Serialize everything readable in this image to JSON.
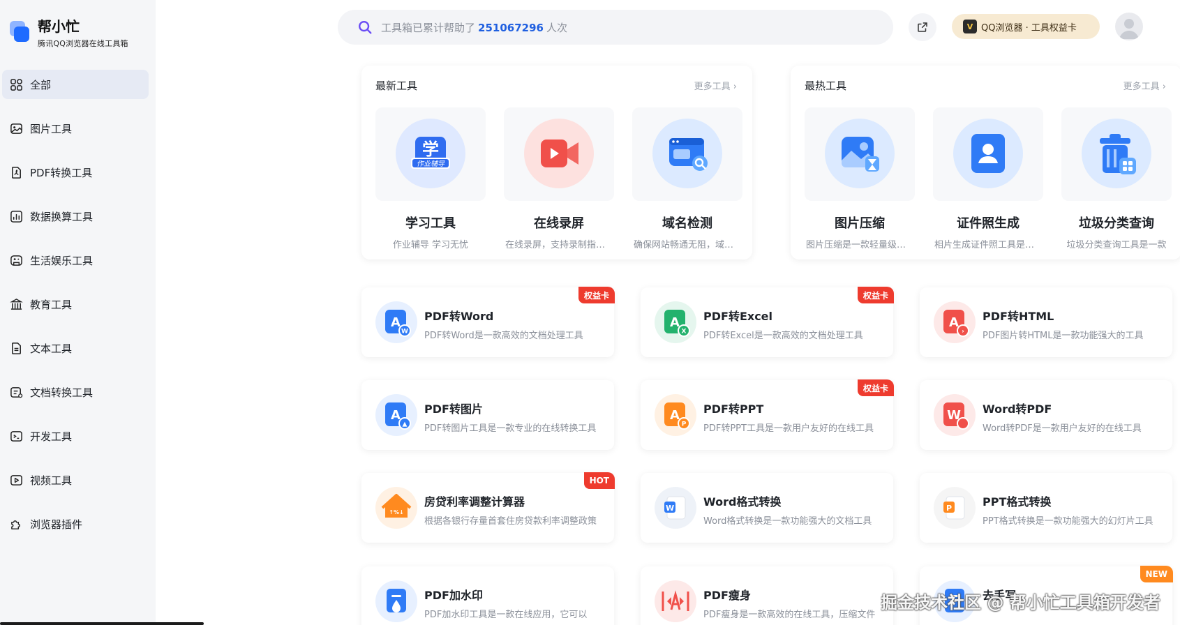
{
  "brand": {
    "title": "帮小忙",
    "subtitle": "腾讯QQ浏览器在线工具箱"
  },
  "sidebar": {
    "items": [
      {
        "label": "全部",
        "icon": "grid-icon",
        "active": true
      },
      {
        "label": "图片工具",
        "icon": "image-icon"
      },
      {
        "label": "PDF转换工具",
        "icon": "pdf-icon"
      },
      {
        "label": "数据换算工具",
        "icon": "chart-icon"
      },
      {
        "label": "生活娱乐工具",
        "icon": "gamepad-icon"
      },
      {
        "label": "教育工具",
        "icon": "school-icon"
      },
      {
        "label": "文本工具",
        "icon": "text-icon"
      },
      {
        "label": "文档转换工具",
        "icon": "doc-convert-icon"
      },
      {
        "label": "开发工具",
        "icon": "terminal-icon"
      },
      {
        "label": "视频工具",
        "icon": "play-icon"
      },
      {
        "label": "浏览器插件",
        "icon": "puzzle-icon"
      }
    ]
  },
  "search": {
    "prefix": "工具箱已累计帮助了",
    "count": "251067296",
    "suffix": "人次"
  },
  "header": {
    "qq_label": "QQ浏览器 · 工具权益卡"
  },
  "panels": [
    {
      "title": "最新工具",
      "more": "更多工具 ›",
      "tools": [
        {
          "name": "学习工具",
          "desc": "作业辅导 学习无忧",
          "icon": "study-icon"
        },
        {
          "name": "在线录屏",
          "desc": "在线录屏，支持录制指定区域",
          "icon": "screen-record-icon"
        },
        {
          "name": "域名检测",
          "desc": "确保网站畅通无阻，域名检测",
          "icon": "domain-check-icon"
        }
      ]
    },
    {
      "title": "最热工具",
      "more": "更多工具 ›",
      "tools": [
        {
          "name": "图片压缩",
          "desc": "图片压缩是一款轻量级工具",
          "icon": "image-compress-icon"
        },
        {
          "name": "证件照生成",
          "desc": "相片生成证件照工具是一款",
          "icon": "id-photo-icon"
        },
        {
          "name": "垃圾分类查询",
          "desc": "垃圾分类查询工具是一款",
          "icon": "trash-sort-icon"
        }
      ]
    }
  ],
  "cards": [
    {
      "title": "PDF转Word",
      "desc": "PDF转Word是一款高效的文档处理工具",
      "badge": "权益卡",
      "badge_color": "red",
      "icon": "pdf-word-icon",
      "color": "#2f7bf6",
      "bg": "#e7f0ff"
    },
    {
      "title": "PDF转Excel",
      "desc": "PDF转Excel是一款高效的文档处理工具",
      "badge": "权益卡",
      "badge_color": "red",
      "icon": "pdf-excel-icon",
      "color": "#23b26d",
      "bg": "#e5f6ee"
    },
    {
      "title": "PDF转HTML",
      "desc": "PDF图片转HTML是一款功能强大的工具",
      "badge": "",
      "badge_color": "",
      "icon": "pdf-html-icon",
      "color": "#f0504a",
      "bg": "#fde9e8"
    },
    {
      "title": "PDF转图片",
      "desc": "PDF转图片工具是一款专业的在线转换工具",
      "badge": "",
      "badge_color": "",
      "icon": "pdf-image-icon",
      "color": "#2f7bf6",
      "bg": "#e7f0ff"
    },
    {
      "title": "PDF转PPT",
      "desc": "PDF转PPT工具是一款用户友好的在线工具",
      "badge": "权益卡",
      "badge_color": "red",
      "icon": "pdf-ppt-icon",
      "color": "#ff8a1f",
      "bg": "#fff1e3"
    },
    {
      "title": "Word转PDF",
      "desc": "Word转PDF是一款用户友好的在线工具",
      "badge": "",
      "badge_color": "",
      "icon": "word-pdf-icon",
      "color": "#f0504a",
      "bg": "#fde9e8"
    },
    {
      "title": "房贷利率调整计算器",
      "desc": "根据各银行存量首套住房贷款利率调整政策",
      "badge": "HOT",
      "badge_color": "red",
      "icon": "house-loan-icon",
      "color": "#ff8a1f",
      "bg": "#fff1e3"
    },
    {
      "title": "Word格式转换",
      "desc": "Word格式转换是一款功能强大的文档工具",
      "badge": "",
      "badge_color": "",
      "icon": "word-format-icon",
      "color": "#2f7bf6",
      "bg": "#eef2f8"
    },
    {
      "title": "PPT格式转换",
      "desc": "PPT格式转换是一款功能强大的幻灯片工具",
      "badge": "",
      "badge_color": "",
      "icon": "ppt-format-icon",
      "color": "#ff8a1f",
      "bg": "#f5f5f5"
    },
    {
      "title": "PDF加水印",
      "desc": "PDF加水印工具是一款在线应用，它可以",
      "badge": "",
      "badge_color": "",
      "icon": "pdf-watermark-icon",
      "color": "#2f7bf6",
      "bg": "#e7f0ff"
    },
    {
      "title": "PDF瘦身",
      "desc": "PDF瘦身是一款高效的在线工具，压缩文件",
      "badge": "",
      "badge_color": "",
      "icon": "pdf-slim-icon",
      "color": "#f0504a",
      "bg": "#fde9e8"
    },
    {
      "title": "去手写",
      "desc": "",
      "badge": "NEW",
      "badge_color": "orange",
      "icon": "remove-handwriting-icon",
      "color": "#2f7bf6",
      "bg": "#e7f0ff"
    }
  ],
  "watermark": "掘金技术社区 @ 帮小忙工具箱开发者"
}
